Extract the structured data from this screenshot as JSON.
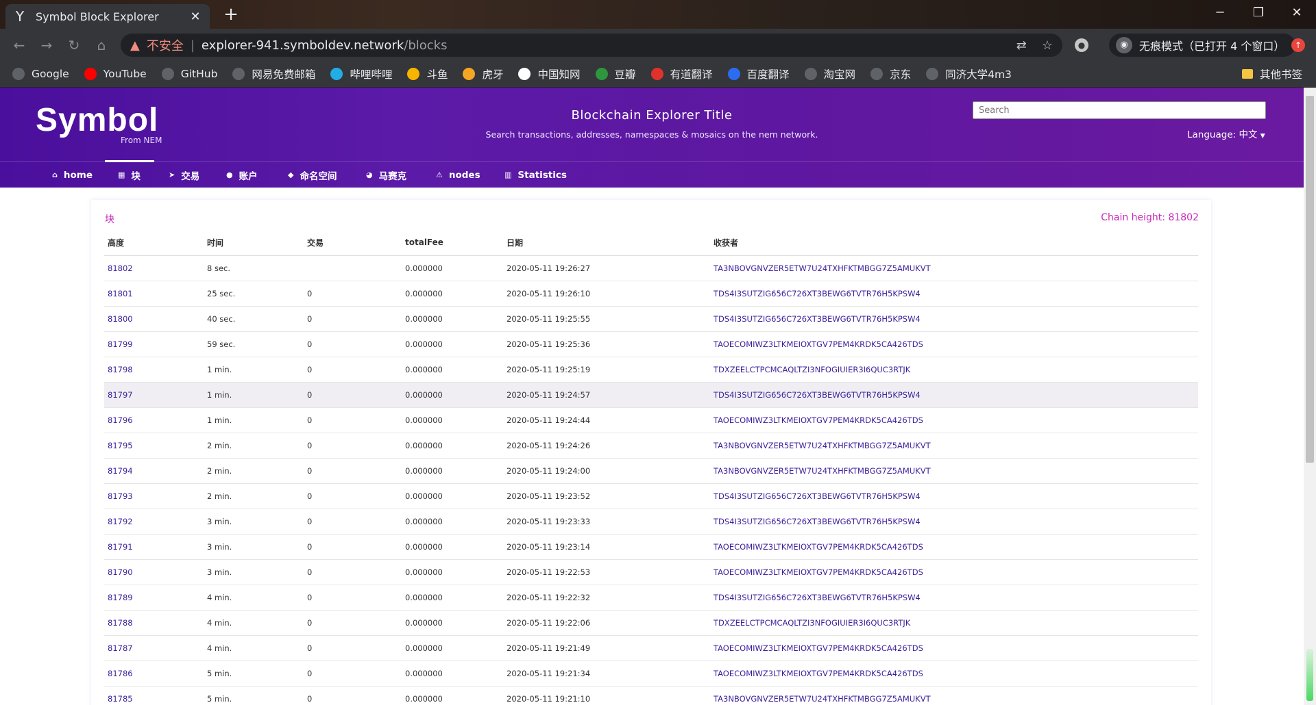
{
  "browser": {
    "tab_title": "Symbol Block Explorer",
    "url_warning": "不安全",
    "url_host": "explorer-941.symboldev.network",
    "url_path": "/blocks",
    "incognito_label": "无痕模式（已打开 4 个窗口）",
    "bookmarks": [
      {
        "label": "Google",
        "icon": "globe-icon",
        "color": "#5f6368"
      },
      {
        "label": "YouTube",
        "icon": "youtube-icon",
        "color": "#ff0000"
      },
      {
        "label": "GitHub",
        "icon": "globe-icon",
        "color": "#5f6368"
      },
      {
        "label": "网易免费邮箱",
        "icon": "globe-icon",
        "color": "#5f6368"
      },
      {
        "label": "哔哩哔哩",
        "icon": "bilibili-icon",
        "color": "#23ade5"
      },
      {
        "label": "斗鱼",
        "icon": "douyu-icon",
        "color": "#f7b500"
      },
      {
        "label": "虎牙",
        "icon": "huya-icon",
        "color": "#f5a623"
      },
      {
        "label": "中国知网",
        "icon": "cnki-icon",
        "color": "#ffffff"
      },
      {
        "label": "豆瓣",
        "icon": "douban-icon",
        "color": "#2e963d"
      },
      {
        "label": "有道翻译",
        "icon": "youdao-icon",
        "color": "#e0322b"
      },
      {
        "label": "百度翻译",
        "icon": "baidu-translate-icon",
        "color": "#2b6cf0"
      },
      {
        "label": "淘宝网",
        "icon": "globe-icon",
        "color": "#5f6368"
      },
      {
        "label": "京东",
        "icon": "globe-icon",
        "color": "#5f6368"
      },
      {
        "label": "同济大学4m3",
        "icon": "globe-icon",
        "color": "#5f6368"
      }
    ],
    "other_bookmarks": "其他书签"
  },
  "header": {
    "logo": "Symbol",
    "logo_sub": "From NEM",
    "title": "Blockchain Explorer Title",
    "subtitle": "Search transactions, addresses, namespaces & mosaics on the nem network.",
    "search_placeholder": "Search",
    "language": "Language: 中文"
  },
  "nav": [
    {
      "label": "home",
      "icon": "home-icon"
    },
    {
      "label": "块",
      "icon": "grid-icon",
      "active": true
    },
    {
      "label": "交易",
      "icon": "send-icon"
    },
    {
      "label": "账户",
      "icon": "user-icon"
    },
    {
      "label": "命名空间",
      "icon": "tag-icon"
    },
    {
      "label": "马赛克",
      "icon": "mosaic-icon"
    },
    {
      "label": "nodes",
      "icon": "nodes-icon"
    },
    {
      "label": "Statistics",
      "icon": "chart-icon"
    }
  ],
  "blocks": {
    "title": "块",
    "chain_height": "Chain height: 81802",
    "columns": [
      "高度",
      "时间",
      "交易",
      "totalFee",
      "日期",
      "收获者"
    ],
    "rows": [
      [
        "81802",
        "8 sec.",
        "",
        "0.000000",
        "2020-05-11 19:26:27",
        "TA3NBOVGNVZER5ETW7U24TXHFKTMBGG7Z5AMUKVT"
      ],
      [
        "81801",
        "25 sec.",
        "0",
        "0.000000",
        "2020-05-11 19:26:10",
        "TDS4I3SUTZIG656C726XT3BEWG6TVTR76H5KPSW4"
      ],
      [
        "81800",
        "40 sec.",
        "0",
        "0.000000",
        "2020-05-11 19:25:55",
        "TDS4I3SUTZIG656C726XT3BEWG6TVTR76H5KPSW4"
      ],
      [
        "81799",
        "59 sec.",
        "0",
        "0.000000",
        "2020-05-11 19:25:36",
        "TAOECOMIWZ3LTKMEIOXTGV7PEM4KRDK5CA426TDS"
      ],
      [
        "81798",
        "1 min.",
        "0",
        "0.000000",
        "2020-05-11 19:25:19",
        "TDXZEELCTPCMCAQLTZI3NFOGIUIER3I6QUC3RTJK"
      ],
      [
        "81797",
        "1 min.",
        "0",
        "0.000000",
        "2020-05-11 19:24:57",
        "TDS4I3SUTZIG656C726XT3BEWG6TVTR76H5KPSW4"
      ],
      [
        "81796",
        "1 min.",
        "0",
        "0.000000",
        "2020-05-11 19:24:44",
        "TAOECOMIWZ3LTKMEIOXTGV7PEM4KRDK5CA426TDS"
      ],
      [
        "81795",
        "2 min.",
        "0",
        "0.000000",
        "2020-05-11 19:24:26",
        "TA3NBOVGNVZER5ETW7U24TXHFKTMBGG7Z5AMUKVT"
      ],
      [
        "81794",
        "2 min.",
        "0",
        "0.000000",
        "2020-05-11 19:24:00",
        "TA3NBOVGNVZER5ETW7U24TXHFKTMBGG7Z5AMUKVT"
      ],
      [
        "81793",
        "2 min.",
        "0",
        "0.000000",
        "2020-05-11 19:23:52",
        "TDS4I3SUTZIG656C726XT3BEWG6TVTR76H5KPSW4"
      ],
      [
        "81792",
        "3 min.",
        "0",
        "0.000000",
        "2020-05-11 19:23:33",
        "TDS4I3SUTZIG656C726XT3BEWG6TVTR76H5KPSW4"
      ],
      [
        "81791",
        "3 min.",
        "0",
        "0.000000",
        "2020-05-11 19:23:14",
        "TAOECOMIWZ3LTKMEIOXTGV7PEM4KRDK5CA426TDS"
      ],
      [
        "81790",
        "3 min.",
        "0",
        "0.000000",
        "2020-05-11 19:22:53",
        "TAOECOMIWZ3LTKMEIOXTGV7PEM4KRDK5CA426TDS"
      ],
      [
        "81789",
        "4 min.",
        "0",
        "0.000000",
        "2020-05-11 19:22:32",
        "TDS4I3SUTZIG656C726XT3BEWG6TVTR76H5KPSW4"
      ],
      [
        "81788",
        "4 min.",
        "0",
        "0.000000",
        "2020-05-11 19:22:06",
        "TDXZEELCTPCMCAQLTZI3NFOGIUIER3I6QUC3RTJK"
      ],
      [
        "81787",
        "4 min.",
        "0",
        "0.000000",
        "2020-05-11 19:21:49",
        "TAOECOMIWZ3LTKMEIOXTGV7PEM4KRDK5CA426TDS"
      ],
      [
        "81786",
        "5 min.",
        "0",
        "0.000000",
        "2020-05-11 19:21:34",
        "TAOECOMIWZ3LTKMEIOXTGV7PEM4KRDK5CA426TDS"
      ],
      [
        "81785",
        "5 min.",
        "0",
        "0.000000",
        "2020-05-11 19:21:10",
        "TA3NBOVGNVZER5ETW7U24TXHFKTMBGG7Z5AMUKVT"
      ]
    ],
    "highlight_row": 5
  },
  "colors": {
    "header_purple": "#5b1aa8",
    "accent_pink": "#c729b7",
    "link_purple": "#3b1f9b"
  }
}
